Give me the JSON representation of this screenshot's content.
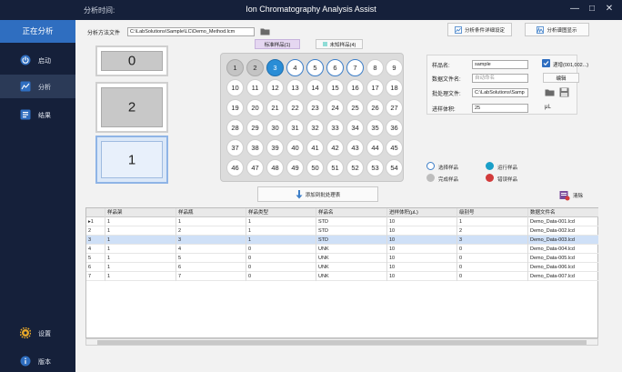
{
  "titlebar": {
    "time_label": "分析时间:",
    "app_title": "Ion Chromatography Analysis Assist",
    "minimize": "—",
    "maximize": "□",
    "close": "✕"
  },
  "sidebar": {
    "header": "正在分析",
    "items": [
      {
        "label": "启动",
        "icon": "power-icon",
        "active": false
      },
      {
        "label": "分析",
        "icon": "analysis-chart-icon",
        "active": true
      },
      {
        "label": "结果",
        "icon": "results-icon",
        "active": false
      }
    ],
    "bottom_items": [
      {
        "label": "设置",
        "icon": "gear-icon"
      },
      {
        "label": "版本",
        "icon": "info-icon"
      }
    ]
  },
  "method": {
    "label": "分析方法文件",
    "value": "C:\\LabSolutions\\Sample\\LC\\Demo_Method.lcm"
  },
  "toolbar": {
    "sample_settings": "分析条件详细设定",
    "spectrum": "分析谱图显示"
  },
  "sample_type_tabs": {
    "standard": "标准样品(1)",
    "unknown": "未知样品(4)"
  },
  "racks": [
    "0",
    "2",
    "1"
  ],
  "positions": {
    "values": [
      "1",
      "2",
      "3",
      "4",
      "5",
      "6",
      "7",
      "8",
      "9",
      "10",
      "11",
      "12",
      "13",
      "14",
      "15",
      "16",
      "17",
      "18",
      "19",
      "20",
      "21",
      "22",
      "23",
      "24",
      "25",
      "26",
      "27",
      "28",
      "29",
      "30",
      "31",
      "32",
      "33",
      "34",
      "35",
      "36",
      "37",
      "38",
      "39",
      "40",
      "41",
      "42",
      "43",
      "44",
      "45",
      "46",
      "47",
      "48",
      "49",
      "50",
      "51",
      "52",
      "53",
      "54"
    ],
    "standard": [
      1,
      2
    ],
    "running": [
      3
    ],
    "selected": [
      4,
      5,
      6,
      7
    ]
  },
  "add_button": "添加到批处理表",
  "form": {
    "sample_name_label": "样品名:",
    "sample_name_value": "sample",
    "data_file_label": "数据文件名:",
    "data_file_value": "自动命名",
    "batch_file_label": "批处理文件:",
    "batch_file_value": "C:\\LabSolutions\\Samp",
    "injection_label": "进样体积:",
    "injection_value": "25",
    "injection_unit": "μL",
    "auto_number_label": "递增(001,002...)",
    "edit_button": "编辑"
  },
  "legend": [
    {
      "label": "选择样品",
      "fill": "#ffffff",
      "stroke": "#3c7ec8"
    },
    {
      "label": "运行样品",
      "fill": "#1a9fc8",
      "stroke": "#1a9fc8"
    },
    {
      "label": "完成样品",
      "fill": "#bdbdbd",
      "stroke": "#bdbdbd"
    },
    {
      "label": "错误样品",
      "fill": "#d23b3b",
      "stroke": "#d23b3b"
    }
  ],
  "clear_button": "清除",
  "table": {
    "headers": [
      "样品架",
      "样品瓶",
      "样品类型",
      "样品名",
      "进样体积(μL)",
      "级别号",
      "数据文件名"
    ],
    "rows": [
      {
        "marker": "▸1",
        "cells": [
          "1",
          "1",
          "1",
          "STD",
          "10",
          "1",
          "Demo_Data-001.lcd"
        ]
      },
      {
        "marker": "2",
        "cells": [
          "1",
          "2",
          "1",
          "STD",
          "10",
          "2",
          "Demo_Data-002.lcd"
        ]
      },
      {
        "marker": "3",
        "cells": [
          "1",
          "3",
          "1",
          "STD",
          "10",
          "3",
          "Demo_Data-003.lcd"
        ]
      },
      {
        "marker": "4",
        "cells": [
          "1",
          "4",
          "0",
          "UNK",
          "10",
          "0",
          "Demo_Data-004.lcd"
        ]
      },
      {
        "marker": "5",
        "cells": [
          "1",
          "5",
          "0",
          "UNK",
          "10",
          "0",
          "Demo_Data-005.lcd"
        ]
      },
      {
        "marker": "6",
        "cells": [
          "1",
          "6",
          "0",
          "UNK",
          "10",
          "0",
          "Demo_Data-006.lcd"
        ]
      },
      {
        "marker": "7",
        "cells": [
          "1",
          "7",
          "0",
          "UNK",
          "10",
          "0",
          "Demo_Data-007.lcd"
        ]
      }
    ],
    "highlighted_row": 3
  },
  "colors": {
    "sidebar_bg": "#15203a",
    "accent": "#2f6ec0",
    "running": "#2a8dd6",
    "standard": "#c4c4c4",
    "error": "#d23b3b"
  }
}
